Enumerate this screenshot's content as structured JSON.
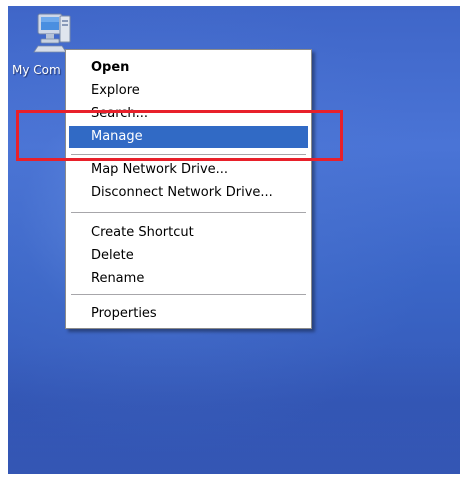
{
  "desktop": {
    "icon_label": "My Com",
    "icon": "my-computer-icon",
    "background_color": "#3f66c8"
  },
  "context_menu": {
    "items": [
      {
        "label": "Open",
        "bold": true
      },
      {
        "label": "Explore"
      },
      {
        "label": "Search..."
      },
      {
        "label": "Manage",
        "selected": true
      },
      {
        "label": "Map Network Drive..."
      },
      {
        "label": "Disconnect Network Drive..."
      },
      {
        "label": "Create Shortcut"
      },
      {
        "label": "Delete"
      },
      {
        "label": "Rename"
      },
      {
        "label": "Properties"
      }
    ],
    "highlight_color": "#316ac5"
  },
  "annotation": {
    "type": "red-rectangle",
    "target": "Manage",
    "color": "#e8202a"
  }
}
